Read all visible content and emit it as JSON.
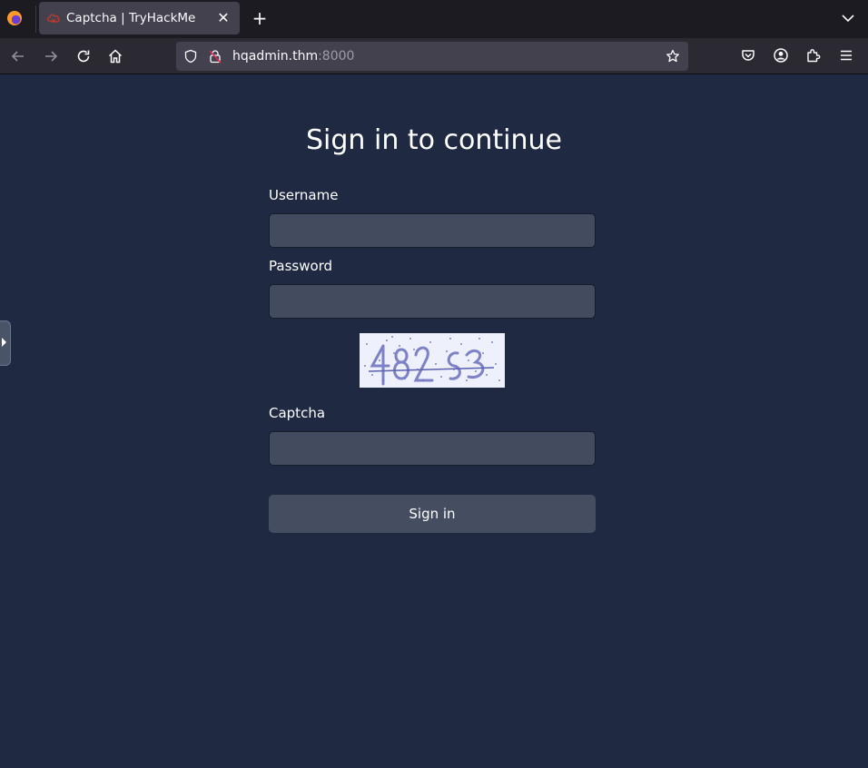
{
  "browser": {
    "tab_title": "Captcha | TryHackMe",
    "url_host": "hqadmin.thm",
    "url_port": ":8000",
    "icons": {
      "back": "arrow-left-icon",
      "forward": "arrow-right-icon",
      "reload": "reload-icon",
      "home": "home-icon",
      "shield": "shield-icon",
      "lock": "insecure-lock-icon",
      "bookmark": "star-icon",
      "pocket": "pocket-icon",
      "account": "account-icon",
      "extensions": "puzzle-icon",
      "menu": "hamburger-menu-icon"
    }
  },
  "form": {
    "heading": "Sign in to continue",
    "username_label": "Username",
    "username_value": "",
    "password_label": "Password",
    "password_value": "",
    "captcha_label": "Captcha",
    "captcha_value": "",
    "submit_label": "Sign in"
  },
  "colors": {
    "page_bg": "#1f2942",
    "input_bg": "#434b5e",
    "button_bg": "#454d60",
    "captcha_ink": "#5a5fb0"
  }
}
